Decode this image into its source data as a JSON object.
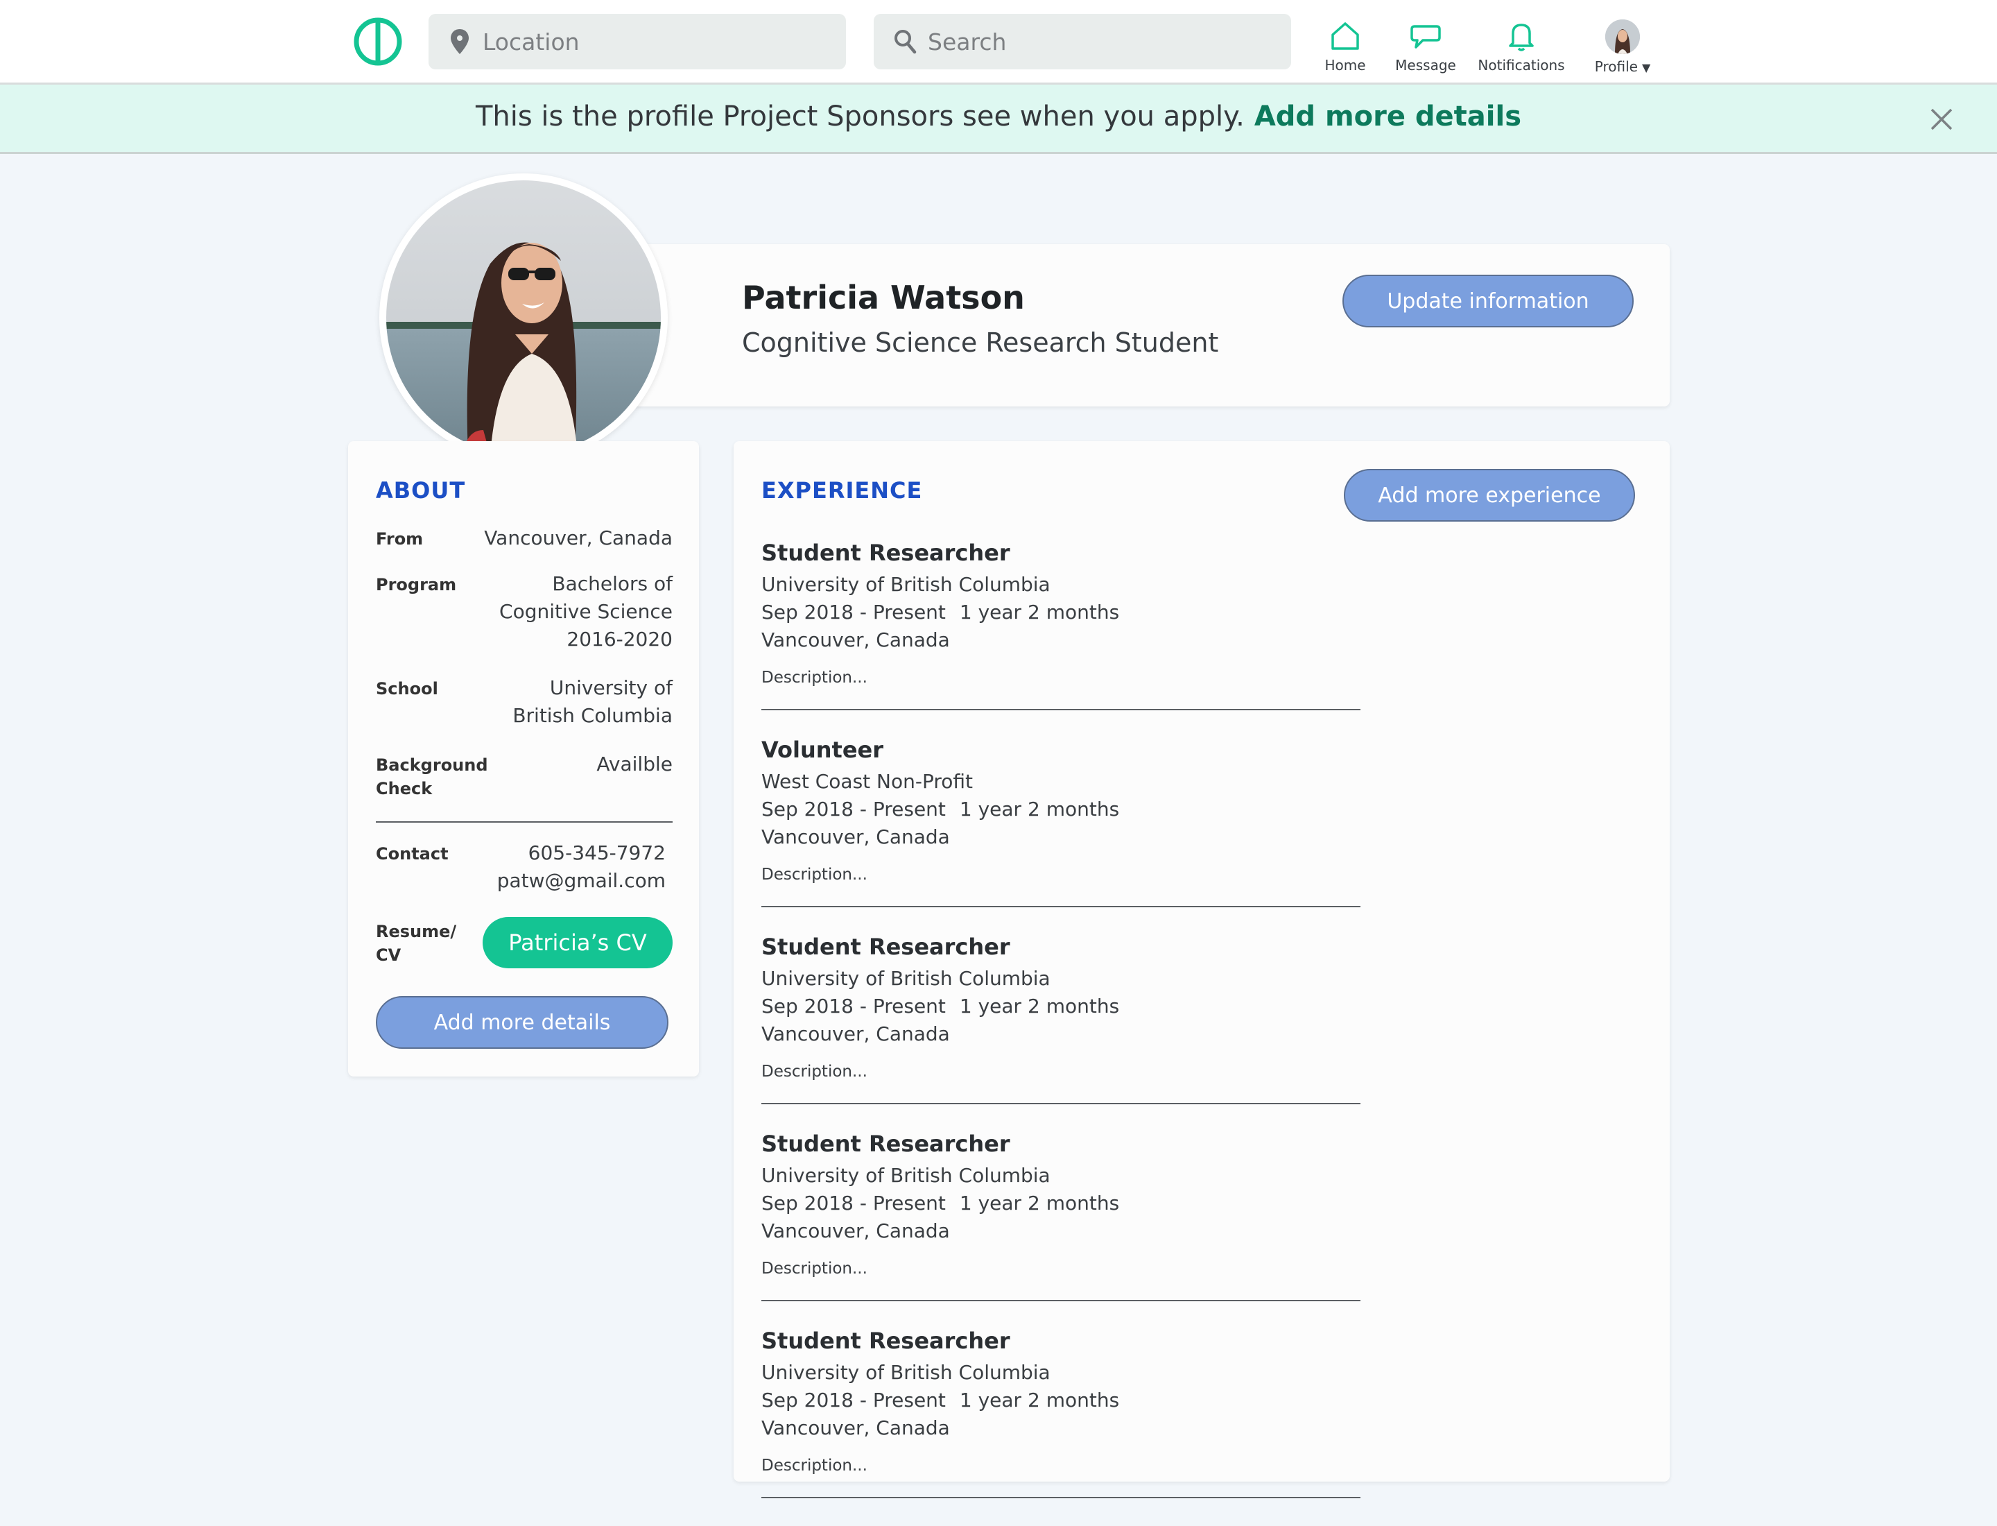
{
  "topbar": {
    "location_placeholder": "Location",
    "search_placeholder": "Search",
    "nav": {
      "home": "Home",
      "message": "Message",
      "notifications": "Notifications",
      "profile": "Profile",
      "profile_caret": "▼"
    }
  },
  "banner": {
    "text": "This is the profile Project Sponsors see when you apply.",
    "link": "Add more details"
  },
  "profile": {
    "name": "Patricia Watson",
    "title": "Cognitive Science Research Student",
    "update_button": "Update information"
  },
  "about": {
    "title": "ABOUT",
    "from_label": "From",
    "from_value": "Vancouver, Canada",
    "program_label": "Program",
    "program_line1": "Bachelors of",
    "program_line2": "Cognitive Science",
    "program_line3": "2016-2020",
    "school_label": "School",
    "school_line1": "University of",
    "school_line2": "British Columbia",
    "background_label": "Background Check",
    "background_value": "Availble",
    "contact_label": "Contact",
    "contact_phone": "605-345-7972",
    "contact_email": "patw@gmail.com",
    "resume_label": "Resume/ CV",
    "cv_button": "Patricia’s CV",
    "add_more_button": "Add more details"
  },
  "experience": {
    "title": "EXPERIENCE",
    "add_button": "Add more experience",
    "items": [
      {
        "role": "Student Researcher",
        "org": "University of British Columbia",
        "dates": "Sep 2018 - Present",
        "duration": "1 year 2 months",
        "location": "Vancouver, Canada",
        "description": "Description..."
      },
      {
        "role": "Volunteer",
        "org": "West Coast Non-Profit",
        "dates": "Sep 2018 - Present",
        "duration": "1 year 2 months",
        "location": "Vancouver, Canada",
        "description": "Description..."
      },
      {
        "role": "Student Researcher",
        "org": "University of British Columbia",
        "dates": "Sep 2018 - Present",
        "duration": "1 year 2 months",
        "location": "Vancouver, Canada",
        "description": "Description..."
      },
      {
        "role": "Student Researcher",
        "org": "University of British Columbia",
        "dates": "Sep 2018 - Present",
        "duration": "1 year 2 months",
        "location": "Vancouver, Canada",
        "description": "Description..."
      },
      {
        "role": "Student Researcher",
        "org": "University of British Columbia",
        "dates": "Sep 2018 - Present",
        "duration": "1 year 2 months",
        "location": "Vancouver, Canada",
        "description": "Description..."
      }
    ]
  },
  "icons": {
    "logo": "logo-icon",
    "location": "location-pin-icon",
    "search": "search-icon",
    "home": "home-icon",
    "message": "message-icon",
    "notifications": "bell-icon",
    "close": "close-icon"
  },
  "colors": {
    "accent_green": "#14c493",
    "link_green": "#0d7a5c",
    "button_blue": "#7b9fde",
    "heading_blue": "#1c4fc5",
    "banner_bg": "#def8f1",
    "page_bg": "#f2f6fa"
  }
}
